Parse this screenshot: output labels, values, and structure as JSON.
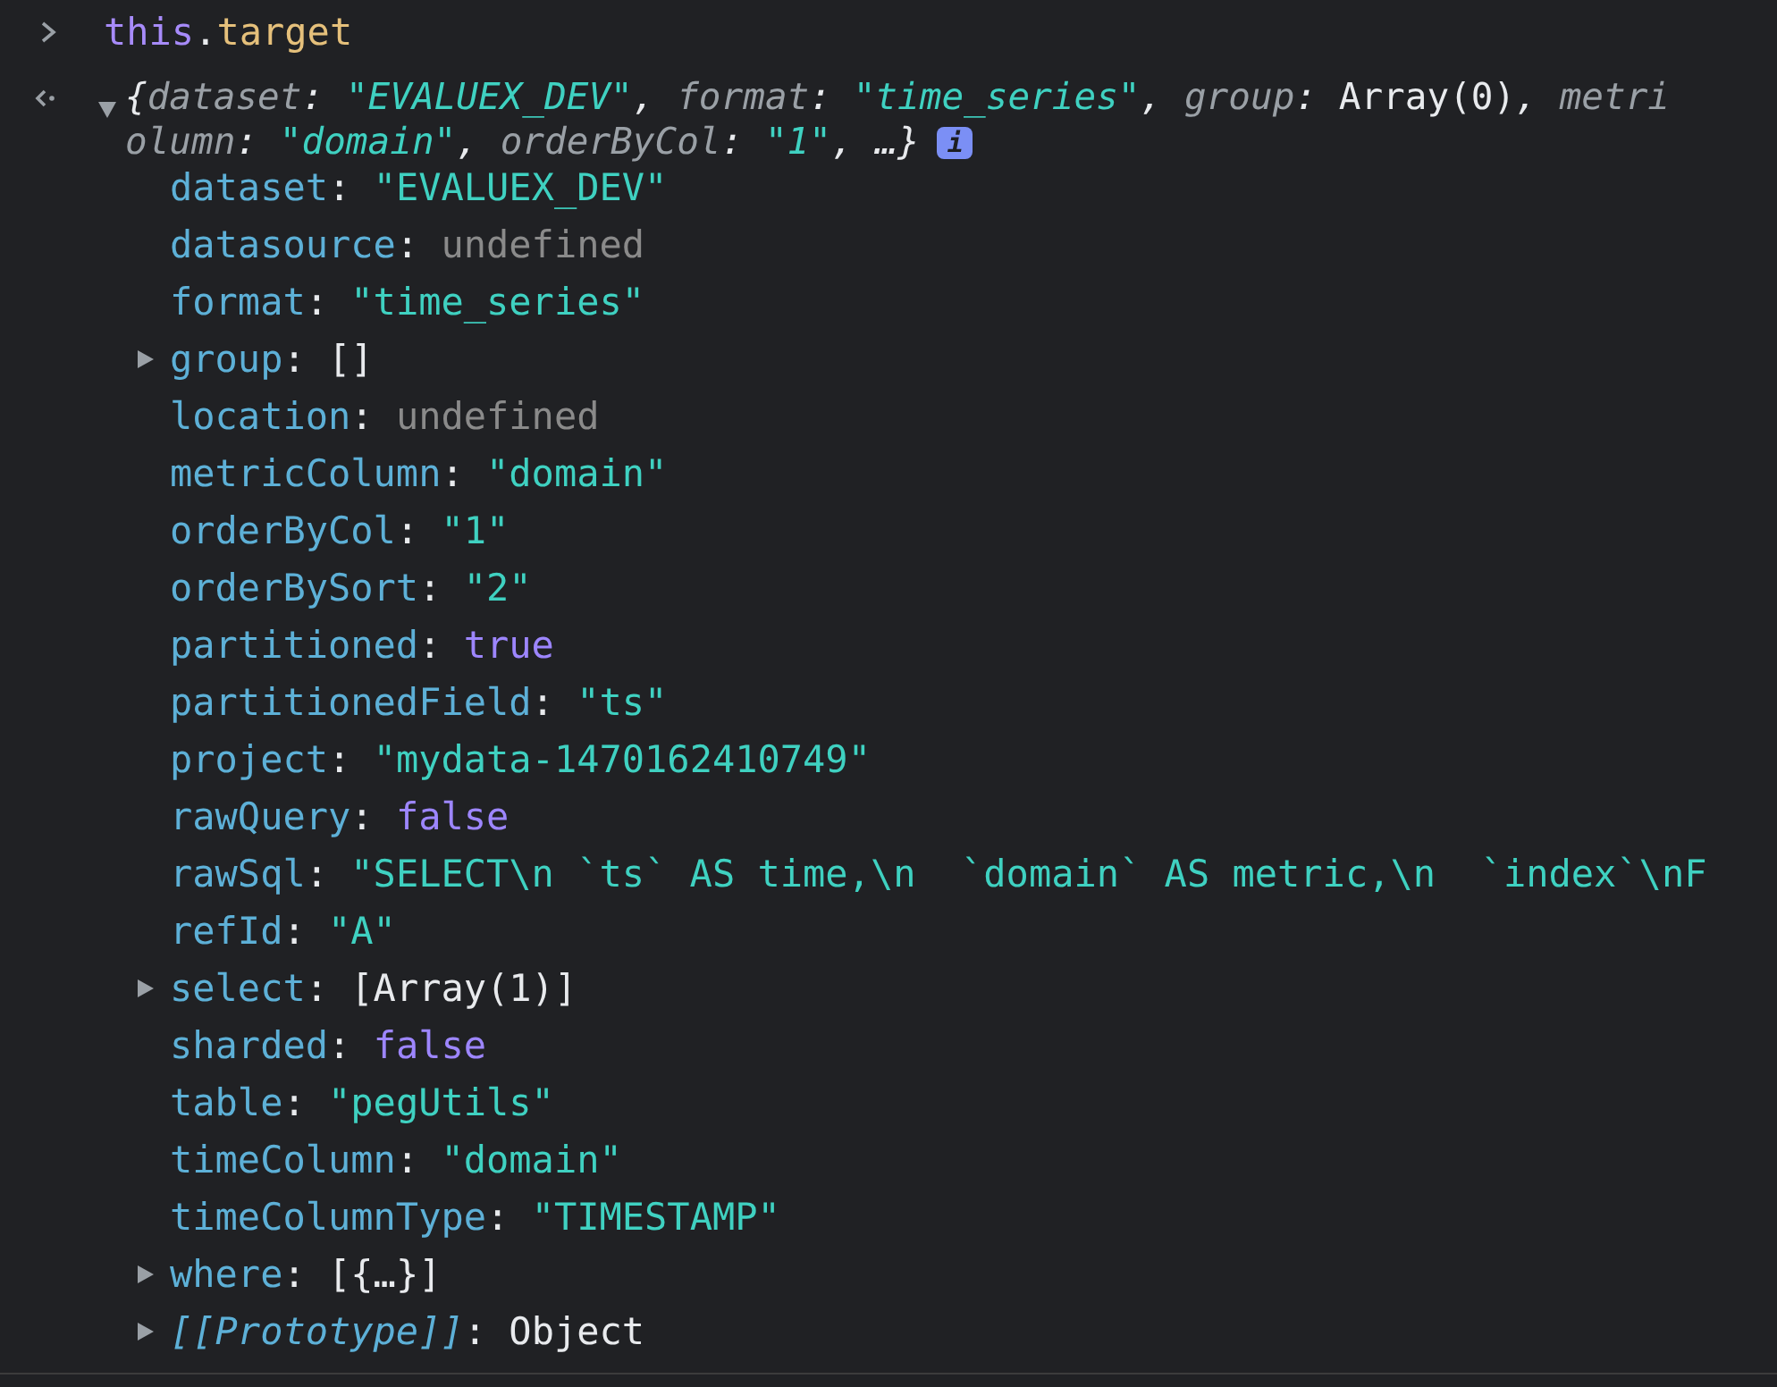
{
  "input": {
    "segments": [
      {
        "text": "this",
        "kind": "keyword"
      },
      {
        "text": ".",
        "kind": "punct"
      },
      {
        "text": "target",
        "kind": "property"
      }
    ]
  },
  "result": {
    "expanded": true,
    "summary_lines": [
      [
        {
          "text": "{",
          "kind": "punct"
        },
        {
          "text": "dataset",
          "kind": "key"
        },
        {
          "text": ": ",
          "kind": "punct"
        },
        {
          "text": "\"EVALUEX_DEV\"",
          "kind": "string"
        },
        {
          "text": ", ",
          "kind": "punct"
        },
        {
          "text": "format",
          "kind": "key"
        },
        {
          "text": ": ",
          "kind": "punct"
        },
        {
          "text": "\"time_series\"",
          "kind": "string"
        },
        {
          "text": ", ",
          "kind": "punct"
        },
        {
          "text": "group",
          "kind": "key"
        },
        {
          "text": ": ",
          "kind": "punct"
        },
        {
          "text": "Array(0)",
          "kind": "plain"
        },
        {
          "text": ", ",
          "kind": "punct"
        },
        {
          "text": "metri",
          "kind": "key"
        }
      ],
      [
        {
          "text": "olumn",
          "kind": "key"
        },
        {
          "text": ": ",
          "kind": "punct"
        },
        {
          "text": "\"domain\"",
          "kind": "string"
        },
        {
          "text": ", ",
          "kind": "punct"
        },
        {
          "text": "orderByCol",
          "kind": "key"
        },
        {
          "text": ": ",
          "kind": "punct"
        },
        {
          "text": "\"1\"",
          "kind": "string"
        },
        {
          "text": ", ",
          "kind": "punct"
        },
        {
          "text": "…}",
          "kind": "punct"
        }
      ]
    ],
    "info_badge": "i",
    "properties": [
      {
        "key": "dataset",
        "separator": ": ",
        "value": "\"EVALUEX_DEV\"",
        "kind": "string"
      },
      {
        "key": "datasource",
        "separator": ": ",
        "value": "undefined",
        "kind": "undefined"
      },
      {
        "key": "format",
        "separator": ": ",
        "value": "\"time_series\"",
        "kind": "string"
      },
      {
        "key": "group",
        "separator": ": ",
        "value": "[]",
        "kind": "plain",
        "expanded": false
      },
      {
        "key": "location",
        "separator": ": ",
        "value": "undefined",
        "kind": "undefined"
      },
      {
        "key": "metricColumn",
        "separator": ": ",
        "value": "\"domain\"",
        "kind": "string"
      },
      {
        "key": "orderByCol",
        "separator": ": ",
        "value": "\"1\"",
        "kind": "string"
      },
      {
        "key": "orderBySort",
        "separator": ": ",
        "value": "\"2\"",
        "kind": "string"
      },
      {
        "key": "partitioned",
        "separator": ": ",
        "value": "true",
        "kind": "boolean"
      },
      {
        "key": "partitionedField",
        "separator": ": ",
        "value": "\"ts\"",
        "kind": "string"
      },
      {
        "key": "project",
        "separator": ": ",
        "value": "\"mydata-1470162410749\"",
        "kind": "string"
      },
      {
        "key": "rawQuery",
        "separator": ": ",
        "value": "false",
        "kind": "boolean"
      },
      {
        "key": "rawSql",
        "separator": ": ",
        "value": "\"SELECT\\n `ts` AS time,\\n  `domain` AS metric,\\n  `index`\\nF",
        "kind": "string"
      },
      {
        "key": "refId",
        "separator": ": ",
        "value": "\"A\"",
        "kind": "string"
      },
      {
        "key": "select",
        "separator": ": ",
        "value": "[Array(1)]",
        "kind": "plain",
        "expanded": false
      },
      {
        "key": "sharded",
        "separator": ": ",
        "value": "false",
        "kind": "boolean"
      },
      {
        "key": "table",
        "separator": ": ",
        "value": "\"pegUtils\"",
        "kind": "string"
      },
      {
        "key": "timeColumn",
        "separator": ": ",
        "value": "\"domain\"",
        "kind": "string"
      },
      {
        "key": "timeColumnType",
        "separator": ": ",
        "value": "\"TIMESTAMP\"",
        "kind": "string"
      },
      {
        "key": "where",
        "separator": ": ",
        "value": "[{…}]",
        "kind": "plain",
        "expanded": false
      },
      {
        "key": "[[Prototype]]",
        "separator": ": ",
        "value": "Object",
        "kind": "plain",
        "internal": true,
        "expanded": false
      }
    ]
  }
}
